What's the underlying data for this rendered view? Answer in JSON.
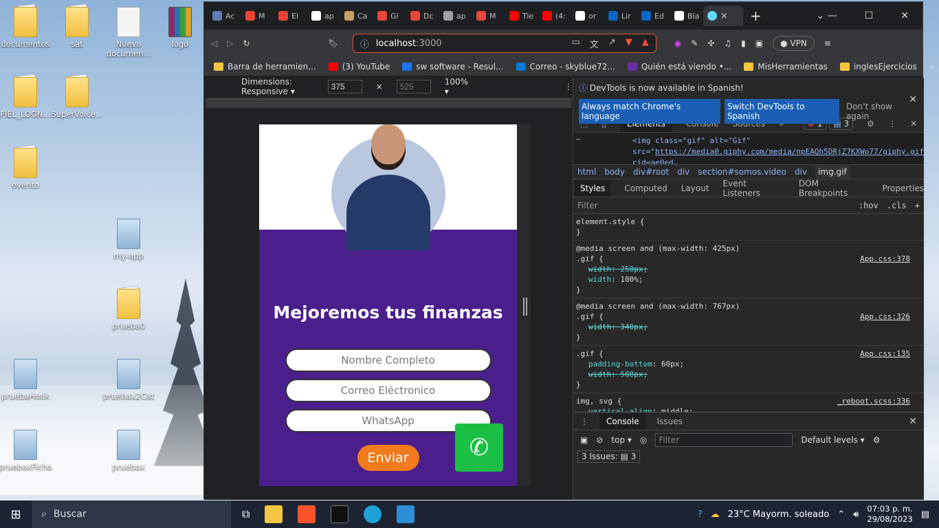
{
  "desktop_icons": [
    {
      "label": "documentos",
      "kind": "folder"
    },
    {
      "label": "sat",
      "kind": "folder"
    },
    {
      "label": "Nuevo documen...",
      "kind": "doc"
    },
    {
      "label": "logo",
      "kind": "rar"
    },
    {
      "label": "FIEL_LOGN...",
      "kind": "folder"
    },
    {
      "label": "SuperVoice...",
      "kind": "folder"
    },
    {
      "label": "evento",
      "kind": "folder"
    },
    {
      "label": "my-app",
      "kind": "blue"
    },
    {
      "label": "prueba0",
      "kind": "folder"
    },
    {
      "label": "pruebaHook",
      "kind": "blue"
    },
    {
      "label": "pruebax2Cat",
      "kind": "blue"
    },
    {
      "label": "pruebaxFicha",
      "kind": "blue"
    },
    {
      "label": "pruebax",
      "kind": "blue"
    }
  ],
  "tabs": [
    {
      "label": "Ac",
      "color": "#5a7fb0"
    },
    {
      "label": "M",
      "color": "#ea4335"
    },
    {
      "label": "El",
      "color": "#ea4335"
    },
    {
      "label": "ap",
      "color": "#ffffff"
    },
    {
      "label": "Ca",
      "color": "#c9a060"
    },
    {
      "label": "Gl",
      "color": "#e8453c"
    },
    {
      "label": "Dc",
      "color": "#e8453c"
    },
    {
      "label": "ap",
      "color": "#9aa0a6"
    },
    {
      "label": "M",
      "color": "#e8453c"
    },
    {
      "label": "Tie",
      "color": "#ff0000"
    },
    {
      "label": "(4:",
      "color": "#ff0000"
    },
    {
      "label": "or",
      "color": "#ffffff"
    },
    {
      "label": "Lir",
      "color": "#0a66c2"
    },
    {
      "label": "Ed",
      "color": "#0a66c2"
    },
    {
      "label": "Bla",
      "color": "#ffffff"
    }
  ],
  "active_tab": {
    "label": "",
    "close": "×"
  },
  "new_tab": "+",
  "window_controls": {
    "minimize": "⌄  —",
    "maximize": "☐",
    "close": "✕"
  },
  "url": {
    "host": "localhost",
    "port": ":3000"
  },
  "vpn": "VPN",
  "bookmarks": [
    {
      "label": "Barra de herramien...",
      "color": "#f4c542"
    },
    {
      "label": "(3) YouTube",
      "color": "#ff0000"
    },
    {
      "label": "sw software - Resul...",
      "color": "#1877f2"
    },
    {
      "label": "Correo - skyblue72...",
      "color": "#0078d4"
    },
    {
      "label": "Quién está viendo •...",
      "color": "#6b2fa0"
    },
    {
      "label": "MisHerramientas",
      "color": "#f4c542"
    },
    {
      "label": "inglesEjercicios",
      "color": "#f4c542"
    }
  ],
  "device_bar": {
    "dimensions": "Dimensions: Responsive ▾",
    "width": "375",
    "height": "525",
    "zoom": "100% ▾",
    "more": "⋮"
  },
  "app": {
    "title": "Mejoremos tus finanzas",
    "name_placeholder": "Nombre Completo",
    "email_placeholder": "Correo Eléctronico",
    "whatsapp_placeholder": "WhatsApp",
    "send": "Enviar"
  },
  "devtools": {
    "banner_text": "DevTools is now available in Spanish!",
    "btn_match": "Always match Chrome's language",
    "btn_switch": "Switch DevTools to Spanish",
    "btn_dont": "Don't show again",
    "tabs": [
      "Elements",
      "Console",
      "Sources"
    ],
    "errors": "1",
    "messages": "3",
    "code_line1": "<img class=\"gif\" alt=\"Gif\" src=\"",
    "code_link": "https://media0.giphy.com/media/npEAQh5DRjZ7KXWo77/giphy.gif?cid=ae0ed…4sht5nelulnaeda1gd8t907h8zn69k5xnvqdp&ep=v1_gifs_search&rid=giphy.gif&ct=",
    "crumbs": [
      "html",
      "body",
      "div#root",
      "div",
      "section#somos.video",
      "div",
      "img.gif"
    ],
    "subtabs": [
      "Styles",
      "Computed",
      "Layout",
      "Event Listeners",
      "DOM Breakpoints",
      "Properties"
    ],
    "filter": "Filter",
    "filter_right": [
      ":hov",
      ".cls",
      "+"
    ],
    "rules": [
      {
        "selector": "element.style {",
        "media": "",
        "src": "",
        "props": []
      },
      {
        "selector": ".gif {",
        "media": "@media screen and (max-width: 425px)",
        "src": "App.css:378",
        "props": [
          {
            "n": "width",
            "v": "250px;",
            "strike": true
          },
          {
            "n": "width",
            "v": "100%;",
            "strike": false
          }
        ]
      },
      {
        "selector": ".gif {",
        "media": "@media screen and (max-width: 767px)",
        "src": "App.css:326",
        "props": [
          {
            "n": "width",
            "v": "340px;",
            "strike": true
          }
        ]
      },
      {
        "selector": ".gif {",
        "media": "",
        "src": "App.css:135",
        "props": [
          {
            "n": "padding-bottom",
            "v": "60px;",
            "strike": false
          },
          {
            "n": "width",
            "v": "500px;",
            "strike": true
          }
        ]
      },
      {
        "selector": "img, svg {",
        "media": "",
        "src": "_reboot.scss:336",
        "props": [
          {
            "n": "vertical-align",
            "v": "middle;",
            "strike": false
          }
        ]
      }
    ],
    "console_tabs": [
      "Console",
      "Issues"
    ],
    "context": "top ▾",
    "console_filter": "Filter",
    "levels": "Default levels ▾",
    "issues": "3 Issues: ▤ 3"
  },
  "taskbar": {
    "search": "Buscar",
    "weather": "23°C  Mayorm. soleado",
    "time": "07:03 p. m.",
    "date": "29/08/2023"
  }
}
